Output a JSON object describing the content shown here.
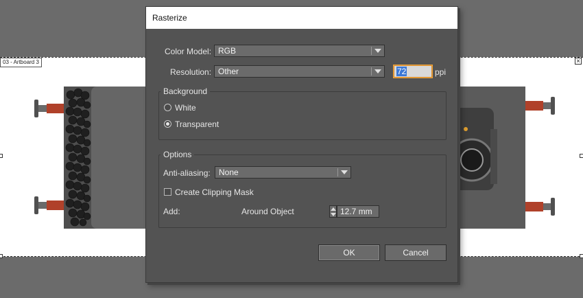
{
  "canvas": {
    "artboard_label": "03 - Artboard 3"
  },
  "dialog": {
    "title": "Rasterize",
    "color_model": {
      "label": "Color Model:",
      "value": "RGB"
    },
    "resolution": {
      "label": "Resolution:",
      "value": "Other",
      "ppi_value": "72",
      "ppi_unit": "ppi"
    },
    "background": {
      "title": "Background",
      "options": [
        {
          "label": "White",
          "checked": false
        },
        {
          "label": "Transparent",
          "checked": true
        }
      ]
    },
    "options": {
      "title": "Options",
      "anti_aliasing": {
        "label": "Anti-aliasing:",
        "value": "None"
      },
      "clipping_mask": {
        "label": "Create Clipping Mask",
        "checked": false
      },
      "add": {
        "label": "Add:",
        "value": "12.7 mm",
        "suffix": "Around Object"
      }
    },
    "buttons": {
      "ok": "OK",
      "cancel": "Cancel"
    }
  },
  "colors": {
    "dialog_bg": "#535353",
    "field_bg": "#6b6b6b",
    "focus_outline": "#f0a53a",
    "selection": "#3b78d6"
  }
}
